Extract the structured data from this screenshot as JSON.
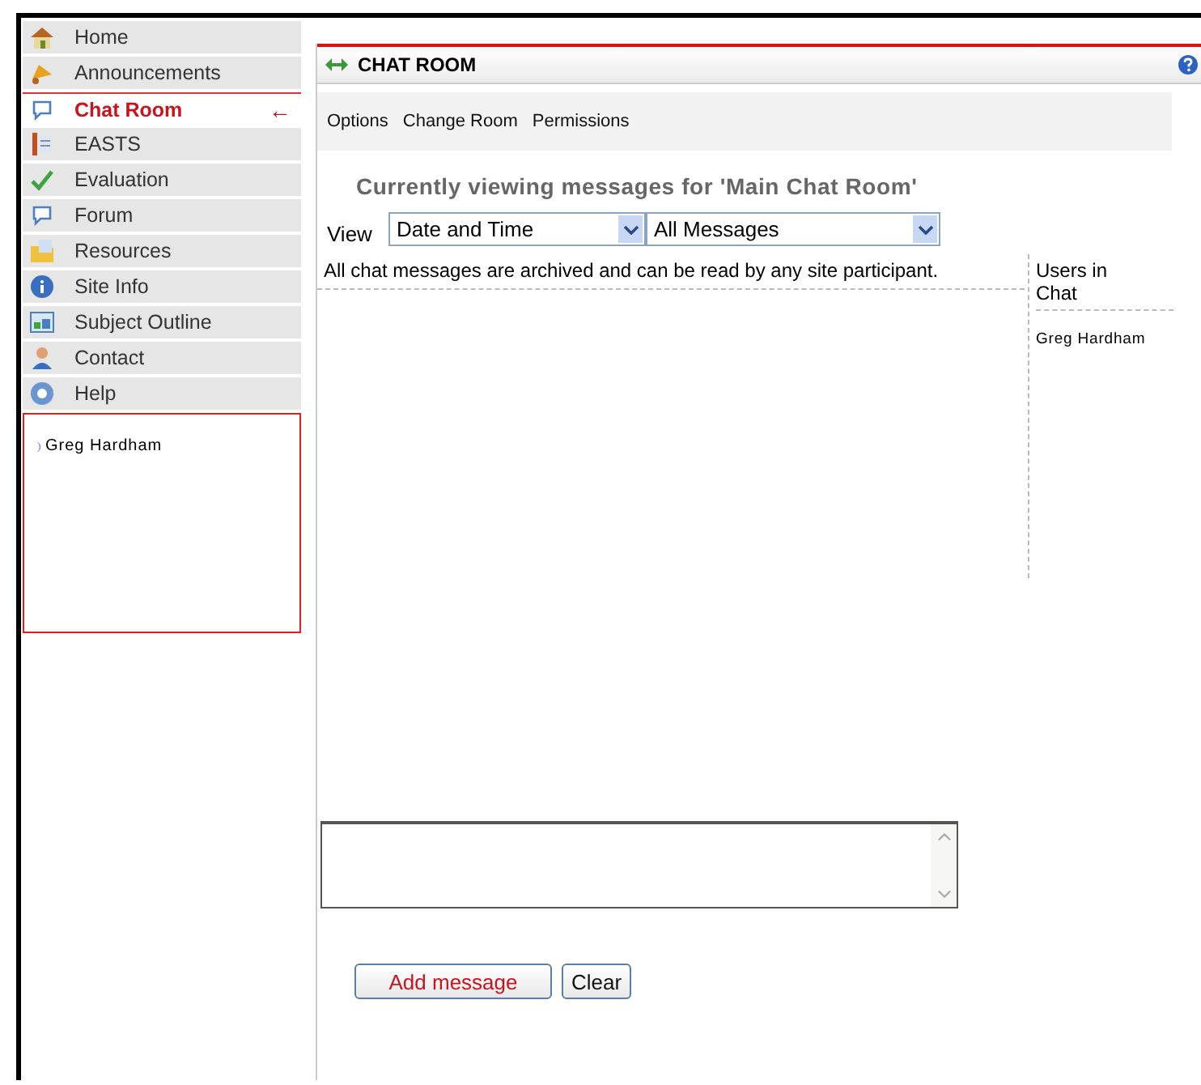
{
  "sidebar": {
    "items": [
      {
        "label": "Home",
        "selected": false
      },
      {
        "label": "Announcements",
        "selected": false
      },
      {
        "label": "Chat Room",
        "selected": true
      },
      {
        "label": "EASTS",
        "selected": false
      },
      {
        "label": "Evaluation",
        "selected": false
      },
      {
        "label": "Forum",
        "selected": false
      },
      {
        "label": "Resources",
        "selected": false
      },
      {
        "label": "Site Info",
        "selected": false
      },
      {
        "label": "Subject Outline",
        "selected": false
      },
      {
        "label": "Contact",
        "selected": false
      },
      {
        "label": "Help",
        "selected": false
      }
    ],
    "selected_marker": "←",
    "present_users": [
      "Greg Hardham"
    ]
  },
  "panel": {
    "title": "CHAT ROOM",
    "menu": [
      "Options",
      "Change Room",
      "Permissions"
    ],
    "heading": "Currently viewing messages for 'Main Chat Room'",
    "view_label": "View",
    "sort_select": "Date and Time",
    "filter_select": "All Messages",
    "notice": "All chat messages are archived and can be read by any site participant.",
    "users_heading": "Users in Chat",
    "users": [
      "Greg Hardham"
    ],
    "buttons": [
      {
        "label": "Add message",
        "kind": "primary"
      },
      {
        "label": "Clear",
        "kind": "plain"
      }
    ]
  }
}
